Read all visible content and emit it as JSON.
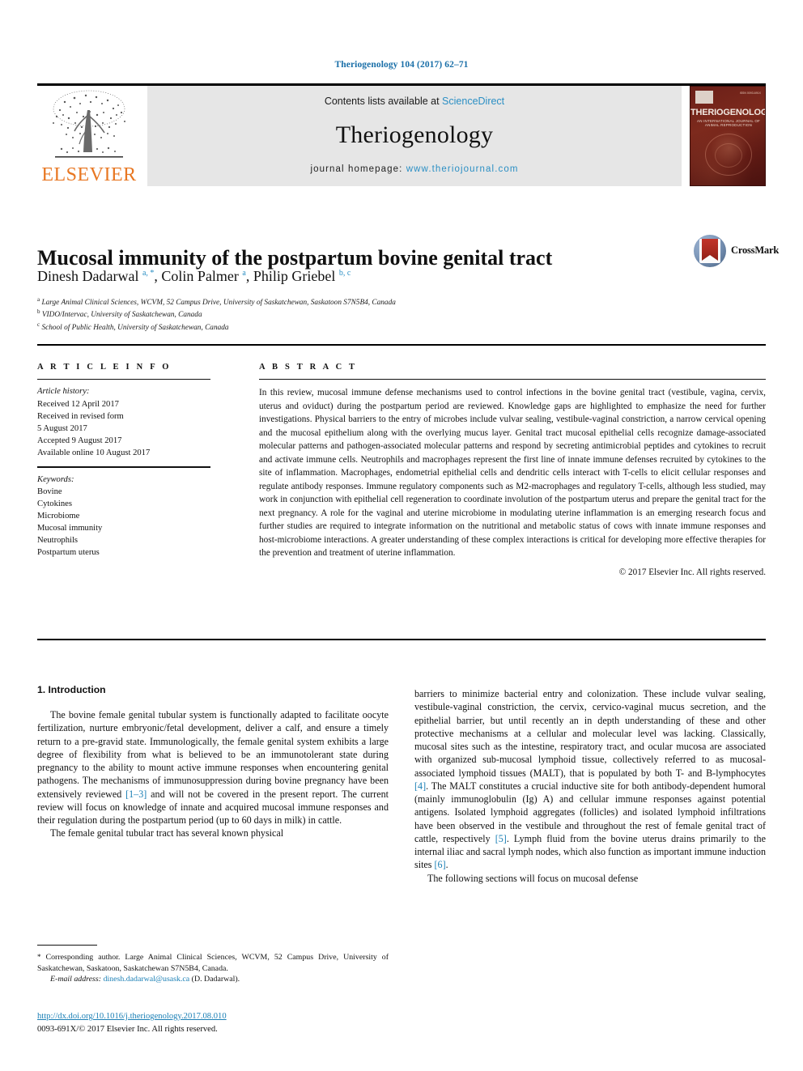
{
  "running_head": "Theriogenology 104 (2017) 62–71",
  "masthead": {
    "publisher_logo_name": "elsevier-logo",
    "publisher_wordmark": "ELSEVIER",
    "contents_prefix": "Contents lists available at ",
    "contents_link": "ScienceDirect",
    "journal_name": "Theriogenology",
    "homepage_prefix": "journal homepage: ",
    "homepage_url": "www.theriojournal.com",
    "cover": {
      "title": "THERIOGENOLOGY",
      "subtitle": "AN INTERNATIONAL JOURNAL OF ANIMAL REPRODUCTION",
      "corner_note": "ISSN 0093-691X"
    }
  },
  "article": {
    "title": "Mucosal immunity of the postpartum bovine genital tract",
    "authors_html": "Dinesh Dadarwal <sup>a, <span class=\"star\">*</span></sup>, Colin Palmer <sup>a</sup>, Philip Griebel <sup>b, c</sup>",
    "affiliations": [
      {
        "marker": "a",
        "text": "Large Animal Clinical Sciences, WCVM, 52 Campus Drive, University of Saskatchewan, Saskatoon S7N5B4, Canada"
      },
      {
        "marker": "b",
        "text": "VIDO/Intervac, University of Saskatchewan, Canada"
      },
      {
        "marker": "c",
        "text": "School of Public Health, University of Saskatchewan, Canada"
      }
    ],
    "crossmark_label": "CrossMark"
  },
  "article_info": {
    "heading": "A R T I C L E   I N F O",
    "history_label": "Article history:",
    "history": [
      "Received 12 April 2017",
      "Received in revised form",
      "5 August 2017",
      "Accepted 9 August 2017",
      "Available online 10 August 2017"
    ],
    "keywords_label": "Keywords:",
    "keywords": [
      "Bovine",
      "Cytokines",
      "Microbiome",
      "Mucosal immunity",
      "Neutrophils",
      "Postpartum uterus"
    ]
  },
  "abstract": {
    "heading": "A B S T R A C T",
    "text": "In this review, mucosal immune defense mechanisms used to control infections in the bovine genital tract (vestibule, vagina, cervix, uterus and oviduct) during the postpartum period are reviewed. Knowledge gaps are highlighted to emphasize the need for further investigations. Physical barriers to the entry of microbes include vulvar sealing, vestibule-vaginal constriction, a narrow cervical opening and the mucosal epithelium along with the overlying mucus layer. Genital tract mucosal epithelial cells recognize damage-associated molecular patterns and pathogen-associated molecular patterns and respond by secreting antimicrobial peptides and cytokines to recruit and activate immune cells. Neutrophils and macrophages represent the first line of innate immune defenses recruited by cytokines to the site of inflammation. Macrophages, endometrial epithelial cells and dendritic cells interact with T-cells to elicit cellular responses and regulate antibody responses. Immune regulatory components such as M2-macrophages and regulatory T-cells, although less studied, may work in conjunction with epithelial cell regeneration to coordinate involution of the postpartum uterus and prepare the genital tract for the next pregnancy. A role for the vaginal and uterine microbiome in modulating uterine inflammation is an emerging research focus and further studies are required to integrate information on the nutritional and metabolic status of cows with innate immune responses and host-microbiome interactions. A greater understanding of these complex interactions is critical for developing more effective therapies for the prevention and treatment of uterine inflammation.",
    "copyright": "© 2017 Elsevier Inc. All rights reserved."
  },
  "body": {
    "section_heading": "1. Introduction",
    "left_paragraphs": [
      "The bovine female genital tubular system is functionally adapted to facilitate oocyte fertilization, nurture embryonic/fetal development, deliver a calf, and ensure a timely return to a pre-gravid state. Immunologically, the female genital system exhibits a large degree of flexibility from what is believed to be an immunotolerant state during pregnancy to the ability to mount active immune responses when encountering genital pathogens. The mechanisms of immunosuppression during bovine pregnancy have been extensively reviewed [1–3] and will not be covered in the present report. The current review will focus on knowledge of innate and acquired mucosal immune responses and their regulation during the postpartum period (up to 60 days in milk) in cattle.",
      "The female genital tubular tract has several known physical"
    ],
    "right_paragraphs": [
      "barriers to minimize bacterial entry and colonization. These include vulvar sealing, vestibule-vaginal constriction, the cervix, cervico-vaginal mucus secretion, and the epithelial barrier, but until recently an in depth understanding of these and other protective mechanisms at a cellular and molecular level was lacking. Classically, mucosal sites such as the intestine, respiratory tract, and ocular mucosa are associated with organized sub-mucosal lymphoid tissue, collectively referred to as mucosal-associated lymphoid tissues (MALT), that is populated by both T- and B-lymphocytes [4]. The MALT constitutes a crucial inductive site for both antibody-dependent humoral (mainly immunoglobulin (Ig) A) and cellular immune responses against potential antigens. Isolated lymphoid aggregates (follicles) and isolated lymphoid infiltrations have been observed in the vestibule and throughout the rest of female genital tract of cattle, respectively [5]. Lymph fluid from the bovine uterus drains primarily to the internal iliac and sacral lymph nodes, which also function as important immune induction sites [6].",
      "The following sections will focus on mucosal defense"
    ],
    "inline_refs": [
      "[1–3]",
      "[4]",
      "[5]",
      "[6]"
    ]
  },
  "footnote": {
    "corresponding": "Corresponding author. Large Animal Clinical Sciences, WCVM, 52 Campus Drive, University of Saskatchewan, Saskatoon, Saskatchewan S7N5B4, Canada.",
    "email_label": "E-mail address:",
    "email": "dinesh.dadarwal@usask.ca",
    "email_suffix": "(D. Dadarwal)."
  },
  "doi_block": {
    "doi_url": "http://dx.doi.org/10.1016/j.theriogenology.2017.08.010",
    "issn_line": "0093-691X/© 2017 Elsevier Inc. All rights reserved."
  },
  "colors": {
    "link_blue": "#1a7fb5",
    "sciencedirect_blue": "#2b8fc4",
    "elsevier_orange": "#E87722",
    "band_grey": "#e6e6e6",
    "cover_maroon": "#6b1f18",
    "crossmark_red": "#c2342a"
  }
}
